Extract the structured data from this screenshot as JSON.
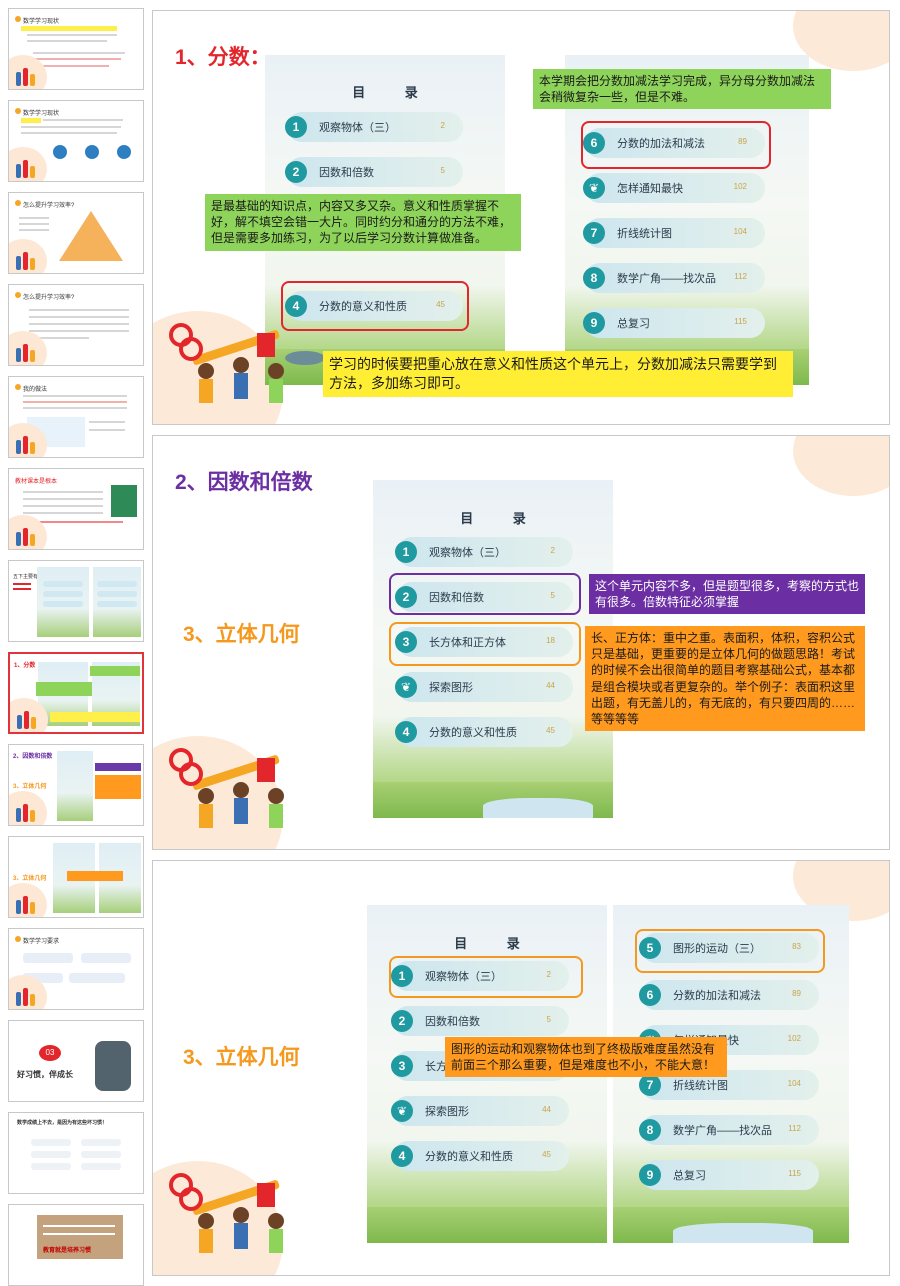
{
  "thumbnails": [
    {
      "label": "数学学习现状"
    },
    {
      "label": "数学学习现状"
    },
    {
      "label": "怎么提升学习效率?"
    },
    {
      "label": "怎么提升学习效率?"
    },
    {
      "label": "我的做法"
    },
    {
      "label": "教材课本是根本"
    },
    {
      "label": "五下主要有"
    },
    {
      "label": "1、分数"
    },
    {
      "label": "2、因数和倍数"
    },
    {
      "label": "3、立体几何"
    },
    {
      "label": "数学学习要求"
    },
    {
      "label": "好习惯，伴成长",
      "number": "03"
    },
    {
      "label": "数学成绩上不去，是因为有这些坏习惯！"
    },
    {
      "label": "教育就是培养习惯"
    }
  ],
  "slide1": {
    "heading": "1、分数：",
    "toc_left": {
      "title": "目 录",
      "items": [
        {
          "num": "1",
          "label": "观察物体（三）",
          "page": "2"
        },
        {
          "num": "2",
          "label": "因数和倍数",
          "page": "5"
        },
        {
          "num": "4",
          "label": "分数的意义和性质",
          "page": "45"
        }
      ]
    },
    "toc_right": {
      "items": [
        {
          "num": "6",
          "label": "分数的加法和减法",
          "page": "89"
        },
        {
          "num": "❦",
          "label": "怎样通知最快",
          "page": "102"
        },
        {
          "num": "7",
          "label": "折线统计图",
          "page": "104"
        },
        {
          "num": "8",
          "label": "数学广角——找次品",
          "page": "112"
        },
        {
          "num": "9",
          "label": "总复习",
          "page": "115"
        }
      ]
    },
    "note_top": "本学期会把分数加减法学习完成，异分母分数加减法会稍微复杂一些，但是不难。",
    "note_left": "是最基础的知识点，内容又多又杂。意义和性质掌握不好，解不填空会错一大片。同时约分和通分的方法不难，但是需要多加练习，为了以后学习分数计算做准备。",
    "note_bottom": "学习的时候要把重心放在意义和性质这个单元上，分数加减法只需要学到方法，多加练习即可。"
  },
  "slide2": {
    "heading_a": "2、因数和倍数",
    "heading_b": "3、立体几何",
    "toc": {
      "title": "目 录",
      "items": [
        {
          "num": "1",
          "label": "观察物体（三）",
          "page": "2"
        },
        {
          "num": "2",
          "label": "因数和倍数",
          "page": "5"
        },
        {
          "num": "3",
          "label": "长方体和正方体",
          "page": "18"
        },
        {
          "num": "❦",
          "label": "探索图形",
          "page": "44"
        },
        {
          "num": "4",
          "label": "分数的意义和性质",
          "page": "45"
        }
      ]
    },
    "note_purple": "这个单元内容不多，但是题型很多，考察的方式也有很多。倍数特征必须掌握",
    "note_orange": "长、正方体：重中之重。表面积，体积，容积公式只是基础，更重要的是立体几何的做题思路！考试的时候不会出很简单的题目考察基础公式，基本都是组合模块或者更复杂的。举个例子：表面积这里出题，有无盖儿的，有无底的，有只要四周的……等等等等"
  },
  "slide3": {
    "heading": "3、立体几何",
    "toc_left": {
      "title": "目 录",
      "items": [
        {
          "num": "1",
          "label": "观察物体（三）",
          "page": "2"
        },
        {
          "num": "2",
          "label": "因数和倍数",
          "page": "5"
        },
        {
          "num": "3",
          "label": "长方体和正方体",
          "page": "18"
        },
        {
          "num": "❦",
          "label": "探索图形",
          "page": "44"
        },
        {
          "num": "4",
          "label": "分数的意义和性质",
          "page": "45"
        }
      ]
    },
    "toc_right": {
      "items": [
        {
          "num": "5",
          "label": "图形的运动（三）",
          "page": "83"
        },
        {
          "num": "6",
          "label": "分数的加法和减法",
          "page": "89"
        },
        {
          "num": "❦",
          "label": "怎样通知最快",
          "page": "102"
        },
        {
          "num": "7",
          "label": "折线统计图",
          "page": "104"
        },
        {
          "num": "8",
          "label": "数学广角——找次品",
          "page": "112"
        },
        {
          "num": "9",
          "label": "总复习",
          "page": "115"
        }
      ]
    },
    "note_orange": "图形的运动和观察物体也到了终极版难度虽然没有前面三个那么重要，但是难度也不小，不能大意！"
  },
  "colors": {
    "red": "#e3262b",
    "purple": "#6b2fa3",
    "orange": "#f5981e",
    "green_note": "#8fd45a",
    "yellow_note": "#ffee33",
    "teal_badge": "#1e9aa0"
  }
}
